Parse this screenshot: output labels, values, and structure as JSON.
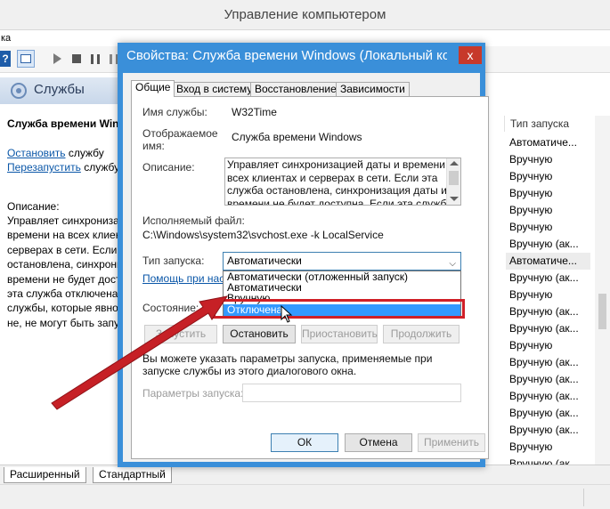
{
  "mmc": {
    "window_title": "Управление компьютером",
    "menu_fragment": "ка",
    "toolbar": {
      "help_icon": "?"
    },
    "services_header": "Службы",
    "selected_service_name": "Служба времени Win",
    "action_stop_link": "Остановить",
    "action_stop_suffix": " службу",
    "action_restart_link": "Перезапустить",
    "action_restart_suffix": " службу",
    "description_label": "Описание:",
    "description_lines": [
      "Управляет синхронизаци",
      "времени на всех клиент",
      "серверах в сети. Если э",
      "остановлена, синхрони",
      "времени не будет досту",
      "эта служба отключена,",
      "службы, которые явно",
      "не, не могут быть запус"
    ],
    "startup_type_header": "Тип запуска",
    "startup_types": [
      "Автоматиче...",
      "Вручную",
      "Вручную",
      "Вручную",
      "Вручную",
      "Вручную",
      "Вручную (ак...",
      "Автоматиче...",
      "Вручную (ак...",
      "Вручную",
      "Вручную (ак...",
      "Вручную (ак...",
      "Вручную",
      "Вручную (ак...",
      "Вручную (ак...",
      "Вручную (ак...",
      "Вручную (ак...",
      "Вручную (ак...",
      "Вручную",
      "Вручную (ак..."
    ],
    "bottom_tabs": [
      "Расширенный",
      "Стандартный"
    ]
  },
  "dialog": {
    "title": "Свойства: Служба времени Windows (Локальный ко...",
    "close_icon": "x",
    "tabs": [
      "Общие",
      "Вход в систему",
      "Восстановление",
      "Зависимости"
    ],
    "service_name_label": "Имя службы:",
    "service_name": "W32Time",
    "display_name_label_1": "Отображаемое",
    "display_name_label_2": "имя:",
    "display_name": "Служба времени Windows",
    "description_label": "Описание:",
    "description_lines": [
      "Управляет синхронизацией даты и времени на",
      "всех клиентах и серверах в сети. Если эта",
      "служба остановлена, синхронизация даты и",
      "времени не будет доступна. Если эта служба"
    ],
    "exe_label": "Исполняемый файл:",
    "exe_path": "C:\\Windows\\system32\\svchost.exe -k LocalService",
    "startup_type_label": "Тип запуска:",
    "startup_type_value": "Автоматически",
    "startup_options": [
      "Автоматически (отложенный запуск)",
      "Автоматически",
      "Вручную",
      "Отключена"
    ],
    "help_link": "Помощь при настройке",
    "state_label": "Состояние:",
    "btn_start": "Запустить",
    "btn_stop": "Остановить",
    "btn_pause": "Приостановить",
    "btn_resume": "Продолжить",
    "info_text": "Вы можете указать параметры запуска, применяемые при запуске службы из этого диалогового окна.",
    "params_label": "Параметры запуска:",
    "params_value": "",
    "btn_ok": "ОК",
    "btn_cancel": "Отмена",
    "btn_apply": "Применить"
  },
  "colors": {
    "dialog_frame": "#3a8fd9",
    "close_button": "#c7392a",
    "selection": "#3399ff",
    "annotation_red": "#d01f27"
  }
}
